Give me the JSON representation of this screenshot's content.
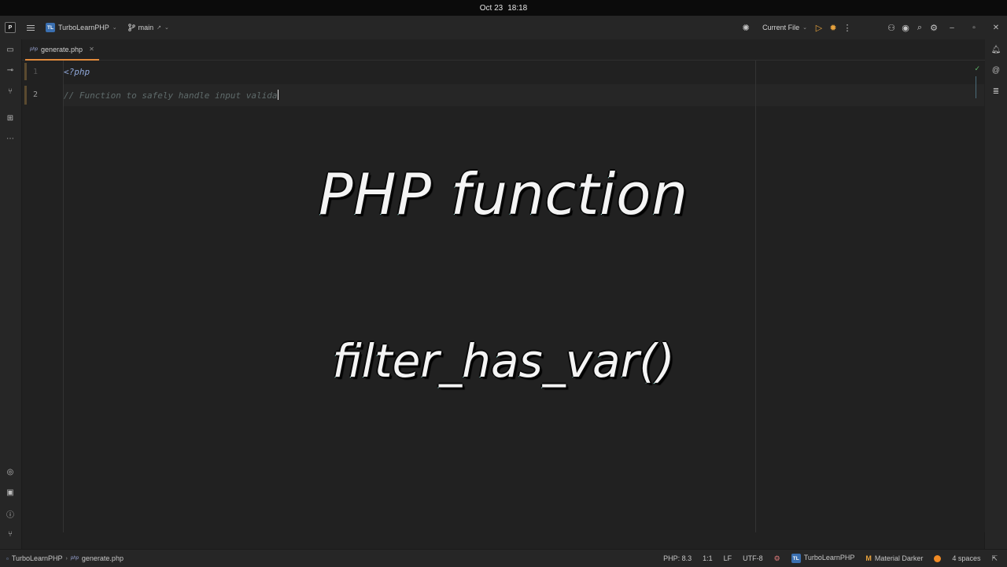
{
  "system": {
    "date": "Oct 23",
    "time": "18:18"
  },
  "titlebar": {
    "project_badge": "TL",
    "project_name": "TurboLearnPHP",
    "branch": "main",
    "run_config": "Current File"
  },
  "tab": {
    "icon_text": "php",
    "filename": "generate.php"
  },
  "editor": {
    "line_numbers": [
      "1",
      "2"
    ],
    "line1": "<?php",
    "line2": "// Function to safely handle input valida"
  },
  "overlay": {
    "title": "PHP function",
    "subtitle": "filter_has_var()"
  },
  "statusbar": {
    "project": "TurboLearnPHP",
    "file_icon_text": "php",
    "file": "generate.php",
    "php_version": "PHP: 8.3",
    "position": "1:1",
    "line_ending": "LF",
    "encoding": "UTF-8",
    "plugin_badge": "TL",
    "plugin_name": "TurboLearnPHP",
    "theme": "Material Darker",
    "indent": "4 spaces"
  },
  "colors": {
    "accent_tab": "#e28a3b",
    "run_icon": "#e8a33d",
    "keyword": "#8fa7d8"
  }
}
